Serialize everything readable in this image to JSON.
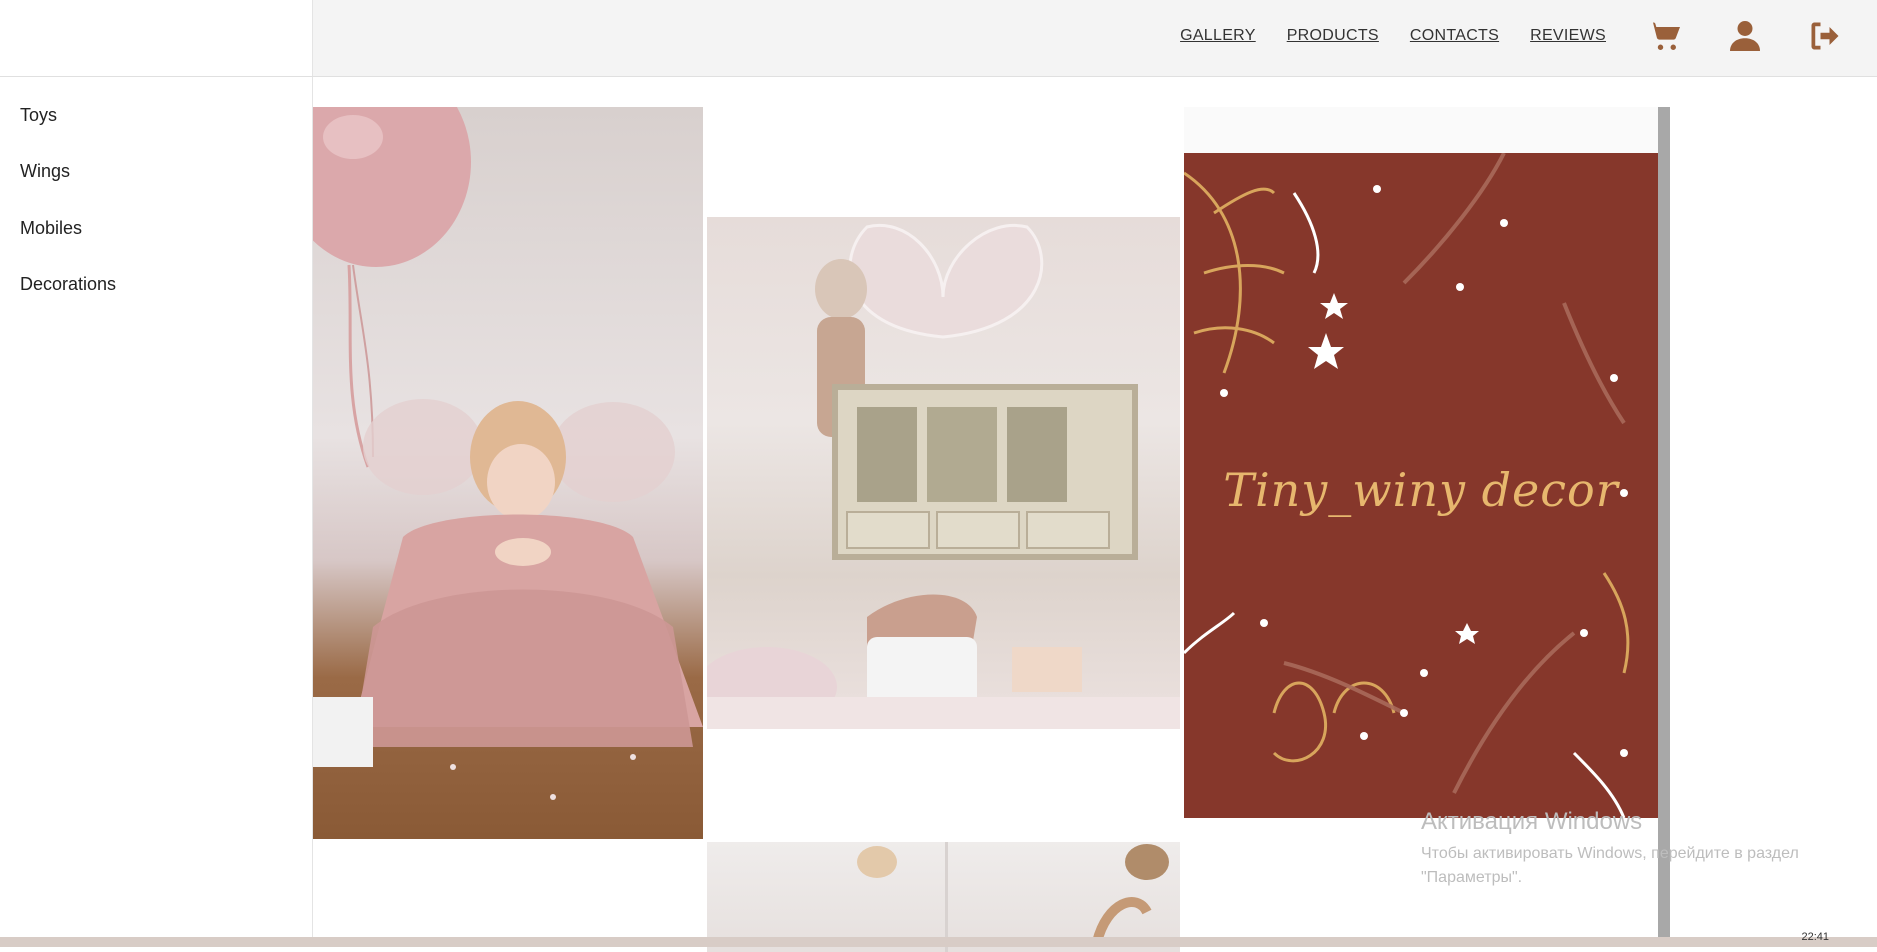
{
  "header": {
    "nav": [
      {
        "label": "GALLERY"
      },
      {
        "label": "PRODUCTS"
      },
      {
        "label": "CONTACTS"
      },
      {
        "label": "REVIEWS"
      }
    ],
    "icons": [
      "cart-icon",
      "user-icon",
      "logout-icon"
    ],
    "icon_color": "#9a603a"
  },
  "sidebar": {
    "items": [
      {
        "label": "Toys"
      },
      {
        "label": "Wings"
      },
      {
        "label": "Mobiles"
      },
      {
        "label": "Decorations"
      }
    ]
  },
  "gallery": {
    "brand_card": {
      "text": "Tiny_winy decor",
      "background": "#86372b",
      "text_color": "#e7b76e"
    }
  },
  "watermark": {
    "title": "Активация Windows",
    "text": "Чтобы активировать Windows, перейдите в раздел \"Параметры\"."
  },
  "taskbar": {
    "clock": "22:41"
  }
}
